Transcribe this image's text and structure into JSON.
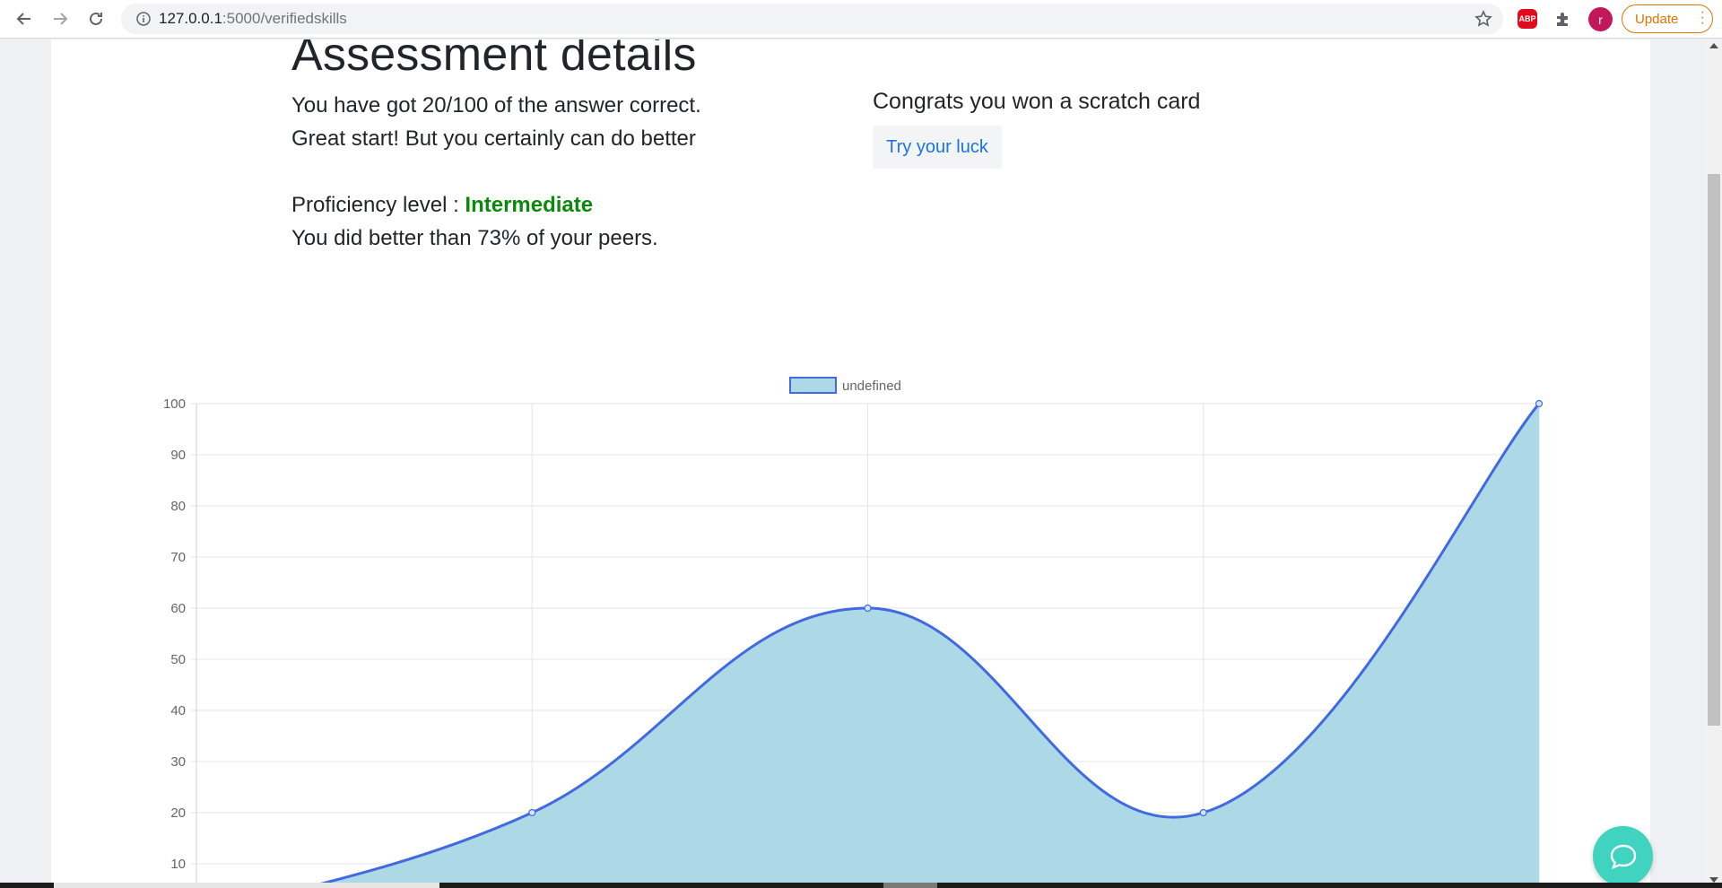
{
  "browser": {
    "url_host": "127.0.0.1",
    "url_rest": ":5000/verifiedskills",
    "abp_label": "ABP",
    "avatar_letter": "r",
    "update_label": "Update"
  },
  "assessment": {
    "title": "Assessment details",
    "score_line": "You have got 20/100 of the answer correct.",
    "encouragement": "Great start! But you certainly can do better",
    "proficiency_label": "Proficiency level : ",
    "proficiency_value": "Intermediate",
    "peers_line": "You did better than 73% of your peers."
  },
  "reward": {
    "heading": "Congrats you won a scratch card",
    "button_label": "Try your luck"
  },
  "chart_data": {
    "type": "area",
    "legend": "undefined",
    "legend_position": "top-center",
    "yticks": [
      100,
      90,
      80,
      70,
      60,
      50,
      40,
      30,
      20,
      10
    ],
    "ylim": [
      0,
      100
    ],
    "grid": true,
    "x": [
      0,
      1,
      2,
      3,
      4
    ],
    "values": [
      0,
      20,
      60,
      20,
      100
    ],
    "fill_color": "#add8e6",
    "line_color": "#4169e1"
  },
  "colors": {
    "proficiency": "#0a8a0a",
    "link": "#1a73e8",
    "chat": "#3fd3c0"
  },
  "icons": {
    "back": "arrow-left-icon",
    "forward": "arrow-right-icon",
    "reload": "reload-icon",
    "info": "info-icon",
    "star": "star-icon",
    "puzzle": "puzzle-icon",
    "chat": "chat-bubble-icon"
  }
}
